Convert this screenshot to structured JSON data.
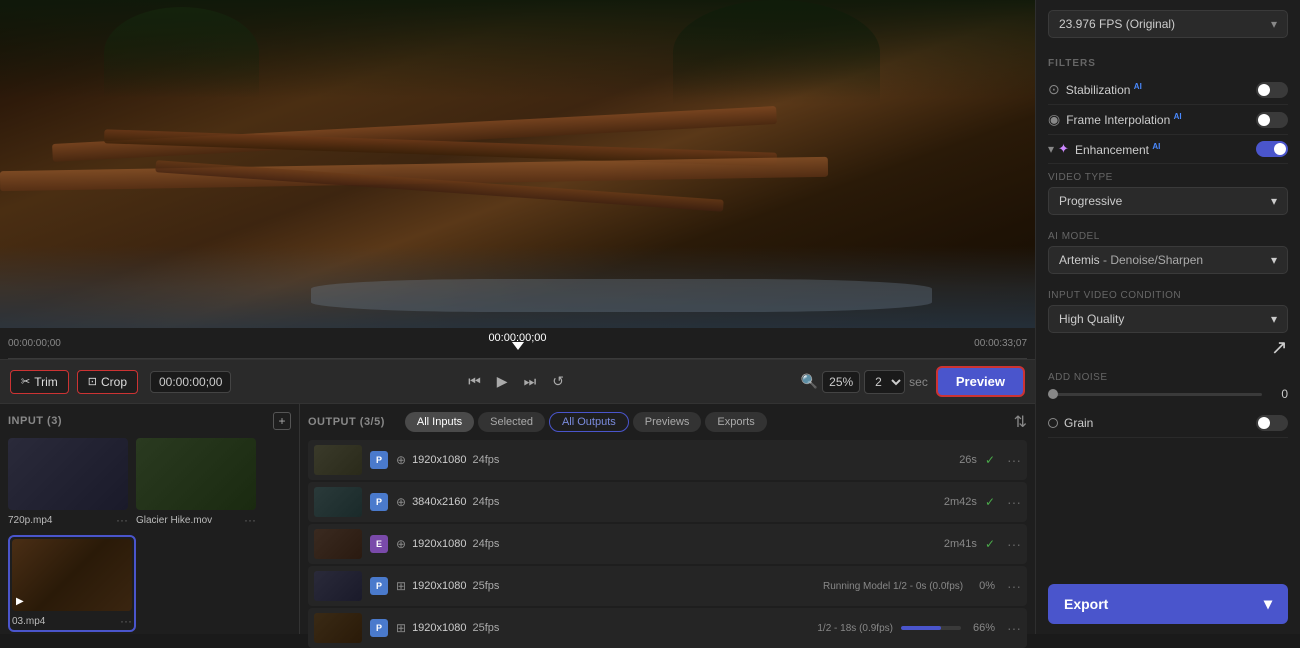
{
  "fps_selector": {
    "label": "23.976 FPS (Original)"
  },
  "filters": {
    "section_label": "FILTERS",
    "stabilization": {
      "label": "Stabilization",
      "ai": true,
      "enabled": false
    },
    "frame_interpolation": {
      "label": "Frame Interpolation",
      "ai": true,
      "enabled": false
    },
    "enhancement": {
      "label": "Enhancement",
      "ai": true,
      "enabled": true
    }
  },
  "video_type": {
    "label": "VIDEO TYPE",
    "value": "Progressive"
  },
  "ai_model": {
    "label": "AI MODEL",
    "value": "Artemis",
    "sub": "- Denoise/Sharpen"
  },
  "input_video_condition": {
    "label": "INPUT VIDEO CONDITION",
    "value": "High Quality"
  },
  "add_noise": {
    "label": "ADD NOISE",
    "value": "0"
  },
  "grain": {
    "label": "Grain",
    "enabled": false
  },
  "export": {
    "label": "Export"
  },
  "timeline": {
    "time_start": "00:00:00;00",
    "time_end": "00:00:33;07",
    "time_current": "00:00:00;00"
  },
  "controls": {
    "trim_label": "Trim",
    "crop_label": "Crop",
    "time_value": "00:00:00;00",
    "zoom_value": "25%",
    "multiplier": "2",
    "sec_label": "sec",
    "preview_label": "Preview"
  },
  "input_panel": {
    "title": "INPUT (3)",
    "files": [
      {
        "name": "720p.mp4",
        "type": "dark"
      },
      {
        "name": "Glacier Hike.mov",
        "type": "forest"
      },
      {
        "name": "03.mp4",
        "type": "bridge"
      }
    ]
  },
  "output_panel": {
    "title": "OUTPUT (3/5)",
    "tabs": [
      "All Inputs",
      "Selected",
      "All Outputs",
      "Previews",
      "Exports"
    ],
    "rows": [
      {
        "badge": "P",
        "badge_type": "p",
        "spec_icon": "⊕",
        "res": "1920x1080",
        "fps": "24fps",
        "duration": "26s",
        "check": true
      },
      {
        "badge": "P",
        "badge_type": "p",
        "spec_icon": "⊕",
        "res": "3840x2160",
        "fps": "24fps",
        "duration": "2m42s",
        "check": true
      },
      {
        "badge": "E",
        "badge_type": "e",
        "spec_icon": "⊕",
        "res": "1920x1080",
        "fps": "24fps",
        "duration": "2m41s",
        "check": true
      },
      {
        "badge": "P",
        "badge_type": "p",
        "spec_icon": "⊞",
        "res": "1920x1080",
        "fps": "25fps",
        "running": "Running Model  1/2 - 0s (0.0fps)",
        "percent": "0%",
        "progress": 0
      },
      {
        "badge": "P",
        "badge_type": "p",
        "spec_icon": "⊞",
        "res": "1920x1080",
        "fps": "25fps",
        "running": "1/2 - 18s (0.9fps)",
        "percent": "66%",
        "progress": 66
      }
    ]
  }
}
